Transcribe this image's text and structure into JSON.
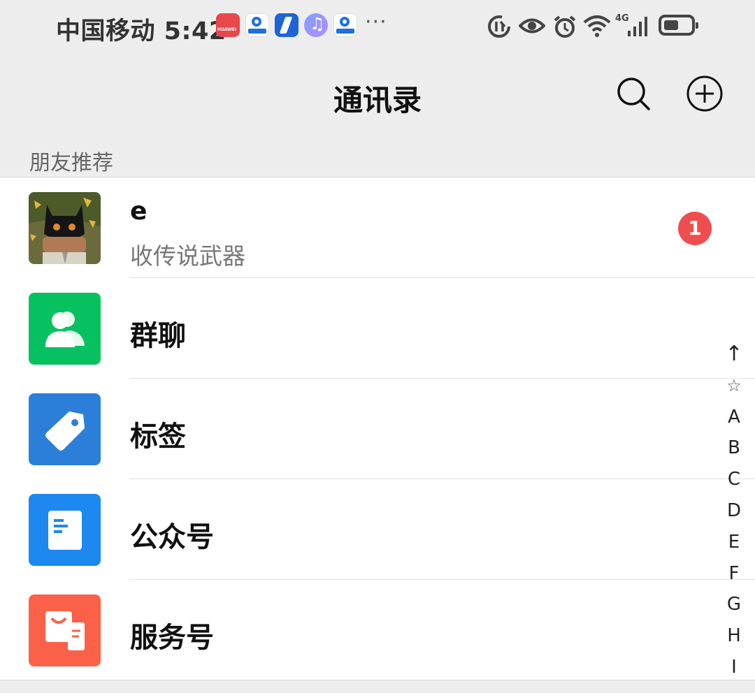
{
  "status_bar": {
    "carrier_time": "中国移动 5:42",
    "huawei_icon_label": "HUAWEI",
    "more": "···",
    "icons": [
      "huawei-appgallery-icon",
      "blue-p-app-icon",
      "bolt-app-icon",
      "music-app-icon",
      "blue-p-app-icon",
      "data-saver-icon",
      "eye-icon",
      "alarm-icon",
      "wifi-icon",
      "signal-4g-icon",
      "battery-icon"
    ]
  },
  "nav": {
    "title": "通讯录",
    "search_icon": "search-icon",
    "add_icon": "plus-circle-icon"
  },
  "section": {
    "recommend_header": "朋友推荐"
  },
  "recommend": {
    "name": "e",
    "message": "收传说武器",
    "badge": "1"
  },
  "items": [
    {
      "label": "群聊",
      "icon": "group-chat-icon",
      "color": "#07c160"
    },
    {
      "label": "标签",
      "icon": "tag-icon",
      "color": "#2b7fd8"
    },
    {
      "label": "公众号",
      "icon": "official-account-icon",
      "color": "#1d88f0"
    },
    {
      "label": "服务号",
      "icon": "service-account-icon",
      "color": "#fa6148"
    }
  ],
  "index": [
    "↑",
    "☆",
    "A",
    "B",
    "C",
    "D",
    "E",
    "F",
    "G",
    "H",
    "I"
  ],
  "colors": {
    "badge": "#f04e4e",
    "background": "#ededed",
    "list_bg": "#ffffff"
  }
}
